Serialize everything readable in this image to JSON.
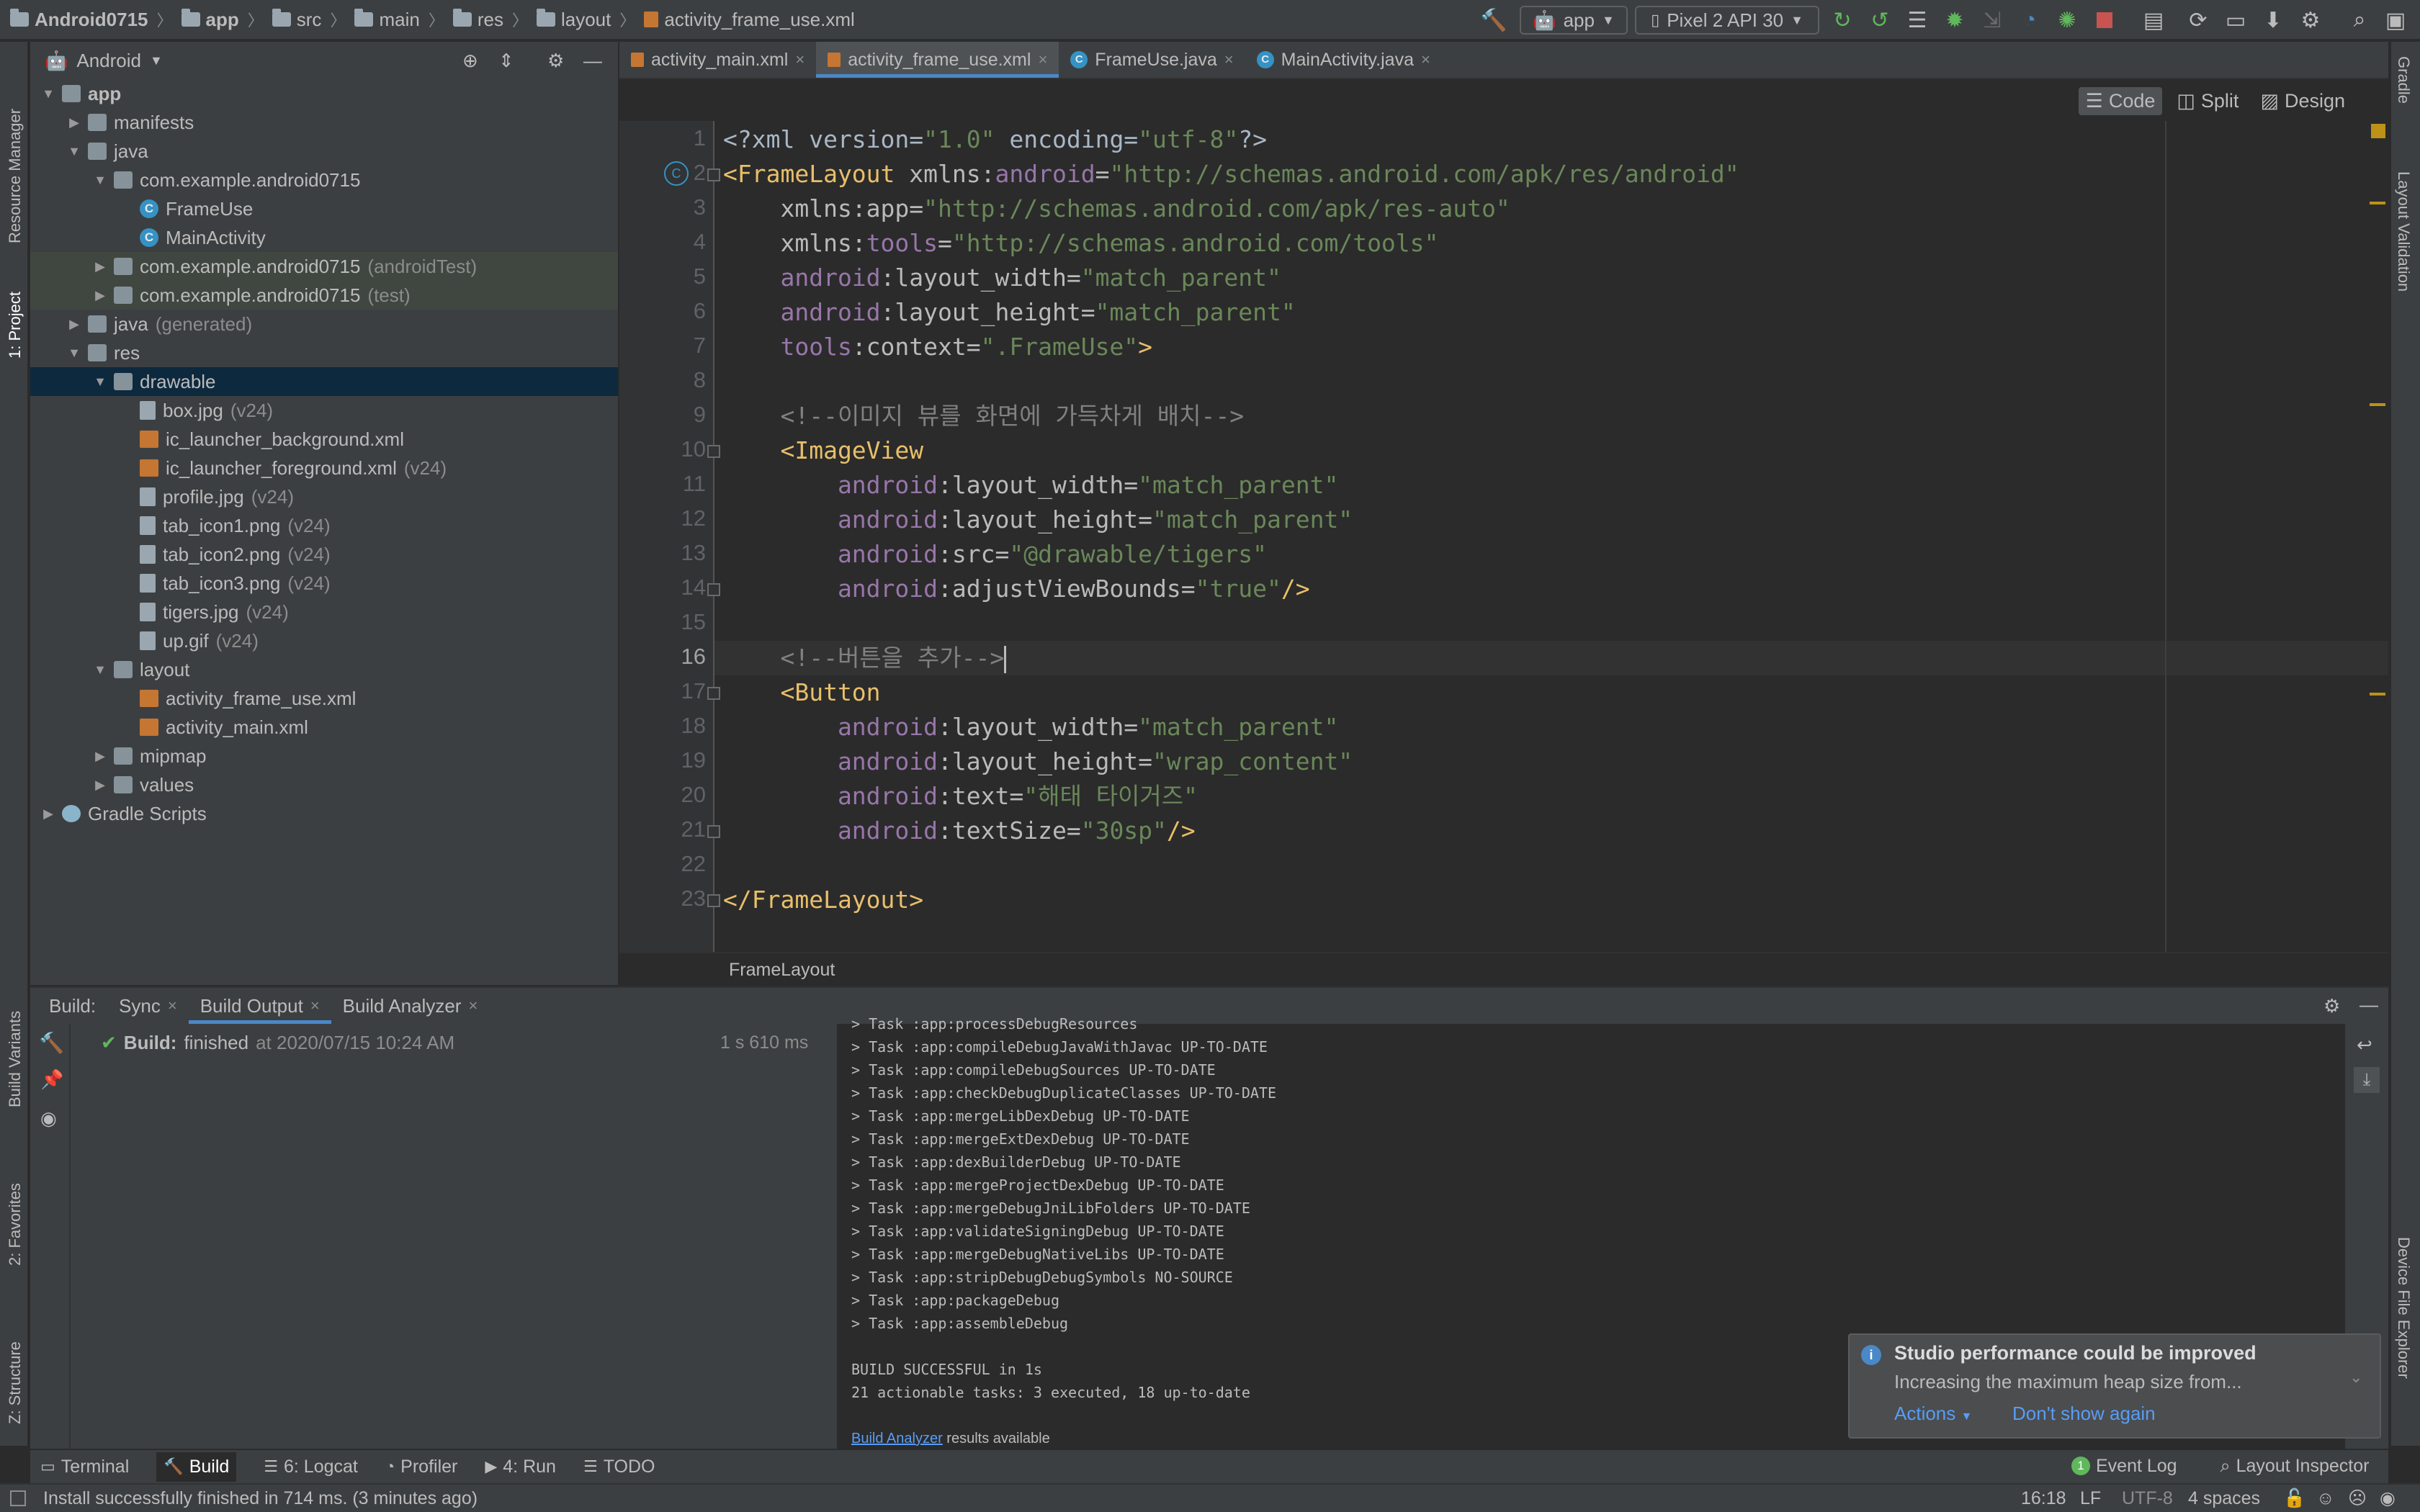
{
  "navbar": {
    "breadcrumbs": [
      "Android0715",
      "app",
      "src",
      "main",
      "res",
      "layout",
      "activity_frame_use.xml"
    ],
    "run_config": "app",
    "device": "Pixel 2 API 30"
  },
  "left_stripe": {
    "resource_manager": "Resource Manager",
    "project": "1: Project",
    "build_variants": "Build Variants",
    "favorites": "2: Favorites",
    "structure": "Z: Structure"
  },
  "right_stripe": {
    "gradle": "Gradle",
    "layout_validation": "Layout Validation",
    "device_file_explorer": "Device File Explorer"
  },
  "project_panel": {
    "view_mode": "Android",
    "tree": [
      {
        "label": "app",
        "suffix": "",
        "icon": "folder-icon",
        "level": 0,
        "arrow": "▼"
      },
      {
        "label": "manifests",
        "suffix": "",
        "icon": "folder-icon",
        "level": 1,
        "arrow": "▶"
      },
      {
        "label": "java",
        "suffix": "",
        "icon": "folder-icon",
        "level": 1,
        "arrow": "▼"
      },
      {
        "label": "com.example.android0715",
        "suffix": "",
        "icon": "package-icon",
        "level": 2,
        "arrow": "▼"
      },
      {
        "label": "FrameUse",
        "suffix": "",
        "icon": "class-icon",
        "level": 3,
        "arrow": ""
      },
      {
        "label": "MainActivity",
        "suffix": "",
        "icon": "class-icon",
        "level": 3,
        "arrow": ""
      },
      {
        "label": "com.example.android0715",
        "suffix": "(androidTest)",
        "icon": "package-icon",
        "level": 2,
        "arrow": "▶"
      },
      {
        "label": "com.example.android0715",
        "suffix": "(test)",
        "icon": "package-icon",
        "level": 2,
        "arrow": "▶"
      },
      {
        "label": "java",
        "suffix": "(generated)",
        "icon": "folder-icon",
        "level": 1,
        "arrow": "▶"
      },
      {
        "label": "res",
        "suffix": "",
        "icon": "folder-icon",
        "level": 1,
        "arrow": "▼"
      },
      {
        "label": "drawable",
        "suffix": "",
        "icon": "folder-icon",
        "level": 2,
        "arrow": "▼"
      },
      {
        "label": "box.jpg",
        "suffix": "(v24)",
        "icon": "image-file-icon",
        "level": 3,
        "arrow": ""
      },
      {
        "label": "ic_launcher_background.xml",
        "suffix": "",
        "icon": "xml-file-icon",
        "level": 3,
        "arrow": ""
      },
      {
        "label": "ic_launcher_foreground.xml",
        "suffix": "(v24)",
        "icon": "xml-file-icon",
        "level": 3,
        "arrow": ""
      },
      {
        "label": "profile.jpg",
        "suffix": "(v24)",
        "icon": "image-file-icon",
        "level": 3,
        "arrow": ""
      },
      {
        "label": "tab_icon1.png",
        "suffix": "(v24)",
        "icon": "image-file-icon",
        "level": 3,
        "arrow": ""
      },
      {
        "label": "tab_icon2.png",
        "suffix": "(v24)",
        "icon": "image-file-icon",
        "level": 3,
        "arrow": ""
      },
      {
        "label": "tab_icon3.png",
        "suffix": "(v24)",
        "icon": "image-file-icon",
        "level": 3,
        "arrow": ""
      },
      {
        "label": "tigers.jpg",
        "suffix": "(v24)",
        "icon": "image-file-icon",
        "level": 3,
        "arrow": ""
      },
      {
        "label": "up.gif",
        "suffix": "(v24)",
        "icon": "image-file-icon",
        "level": 3,
        "arrow": ""
      },
      {
        "label": "layout",
        "suffix": "",
        "icon": "folder-icon",
        "level": 2,
        "arrow": "▼"
      },
      {
        "label": "activity_frame_use.xml",
        "suffix": "",
        "icon": "xml-file-icon",
        "level": 3,
        "arrow": ""
      },
      {
        "label": "activity_main.xml",
        "suffix": "",
        "icon": "xml-file-icon",
        "level": 3,
        "arrow": ""
      },
      {
        "label": "mipmap",
        "suffix": "",
        "icon": "folder-icon",
        "level": 2,
        "arrow": "▶"
      },
      {
        "label": "values",
        "suffix": "",
        "icon": "folder-icon",
        "level": 2,
        "arrow": "▶"
      },
      {
        "label": "Gradle Scripts",
        "suffix": "",
        "icon": "gradle-icon",
        "level": 0,
        "arrow": "▶"
      }
    ]
  },
  "editor": {
    "tabs": [
      {
        "label": "activity_main.xml",
        "icon": "xml-file-icon",
        "active": false
      },
      {
        "label": "activity_frame_use.xml",
        "icon": "xml-file-icon",
        "active": true
      },
      {
        "label": "FrameUse.java",
        "icon": "class-icon",
        "active": false
      },
      {
        "label": "MainActivity.java",
        "icon": "class-icon",
        "active": false
      }
    ],
    "view_modes": {
      "code": "Code",
      "split": "Split",
      "design": "Design"
    },
    "current_line": 16,
    "lines": [
      [
        [
          "p",
          "<?xml version="
        ],
        [
          "v",
          "\"1.0\""
        ],
        [
          "p",
          " encoding="
        ],
        [
          "v",
          "\"utf-8\""
        ],
        [
          "p",
          "?>"
        ]
      ],
      [
        [
          "t",
          "<FrameLayout "
        ],
        [
          "a",
          "xmlns:"
        ],
        [
          "ns",
          "android"
        ],
        [
          "a",
          "="
        ],
        [
          "v",
          "\"http://schemas.android.com/apk/res/android\""
        ]
      ],
      [
        [
          "a",
          "    xmlns:app="
        ],
        [
          "v",
          "\"http://schemas.android.com/apk/res-auto\""
        ]
      ],
      [
        [
          "a",
          "    xmlns:"
        ],
        [
          "ns",
          "tools"
        ],
        [
          "a",
          "="
        ],
        [
          "v",
          "\"http://schemas.android.com/tools\""
        ]
      ],
      [
        [
          "ns",
          "    android"
        ],
        [
          "a",
          ":layout_width="
        ],
        [
          "v",
          "\"match_parent\""
        ]
      ],
      [
        [
          "ns",
          "    android"
        ],
        [
          "a",
          ":layout_height="
        ],
        [
          "v",
          "\"match_parent\""
        ]
      ],
      [
        [
          "ns",
          "    tools"
        ],
        [
          "a",
          ":context="
        ],
        [
          "v",
          "\".FrameUse\""
        ],
        [
          "t",
          ">"
        ]
      ],
      [],
      [
        [
          "c",
          "    <!--이미지 뷰를 화면에 가득차게 배치-->"
        ]
      ],
      [
        [
          "t",
          "    <ImageView"
        ]
      ],
      [
        [
          "ns",
          "        android"
        ],
        [
          "a",
          ":layout_width="
        ],
        [
          "v",
          "\"match_parent\""
        ]
      ],
      [
        [
          "ns",
          "        android"
        ],
        [
          "a",
          ":layout_height="
        ],
        [
          "v",
          "\"match_parent\""
        ]
      ],
      [
        [
          "ns",
          "        android"
        ],
        [
          "a",
          ":src="
        ],
        [
          "v",
          "\"@drawable/tigers\""
        ]
      ],
      [
        [
          "ns",
          "        android"
        ],
        [
          "a",
          ":adjustViewBounds="
        ],
        [
          "v",
          "\"true\""
        ],
        [
          "t",
          "/>"
        ]
      ],
      [],
      [
        [
          "c",
          "    <!--버튼을 추가-->"
        ]
      ],
      [
        [
          "t",
          "    <Button"
        ]
      ],
      [
        [
          "ns",
          "        android"
        ],
        [
          "a",
          ":layout_width="
        ],
        [
          "v",
          "\"match_parent\""
        ]
      ],
      [
        [
          "ns",
          "        android"
        ],
        [
          "a",
          ":layout_height="
        ],
        [
          "v",
          "\"wrap_content\""
        ]
      ],
      [
        [
          "ns",
          "        android"
        ],
        [
          "a",
          ":text="
        ],
        [
          "v",
          "\"해태 타이거즈\""
        ]
      ],
      [
        [
          "ns",
          "        android"
        ],
        [
          "a",
          ":textSize="
        ],
        [
          "v",
          "\"30sp\""
        ],
        [
          "t",
          "/>"
        ]
      ],
      [],
      [
        [
          "t",
          "</FrameLayout>"
        ]
      ]
    ],
    "breadcrumb": "FrameLayout"
  },
  "build": {
    "label": "Build:",
    "tabs": [
      {
        "label": "Sync",
        "active": false
      },
      {
        "label": "Build Output",
        "active": true
      },
      {
        "label": "Build Analyzer",
        "active": false
      }
    ],
    "status_bold": "Build:",
    "status": "finished",
    "status_time": "at 2020/07/15 10:24 AM",
    "duration": "1 s 610 ms",
    "output": [
      "> Task :app:processDebugResources",
      "> Task :app:compileDebugJavaWithJavac UP-TO-DATE",
      "> Task :app:compileDebugSources UP-TO-DATE",
      "> Task :app:checkDebugDuplicateClasses UP-TO-DATE",
      "> Task :app:mergeLibDexDebug UP-TO-DATE",
      "> Task :app:mergeExtDexDebug UP-TO-DATE",
      "> Task :app:dexBuilderDebug UP-TO-DATE",
      "> Task :app:mergeProjectDexDebug UP-TO-DATE",
      "> Task :app:mergeDebugJniLibFolders UP-TO-DATE",
      "> Task :app:validateSigningDebug UP-TO-DATE",
      "> Task :app:mergeDebugNativeLibs UP-TO-DATE",
      "> Task :app:stripDebugDebugSymbols NO-SOURCE",
      "> Task :app:packageDebug",
      "> Task :app:assembleDebug",
      "",
      "BUILD SUCCESSFUL in 1s",
      "21 actionable tasks: 3 executed, 18 up-to-date",
      ""
    ],
    "analyzer_link": "Build Analyzer",
    "analyzer_suffix": " results available"
  },
  "notification": {
    "title": "Studio performance could be improved",
    "body": "Increasing the maximum heap size from...",
    "actions": "Actions",
    "dismiss": "Don't show again"
  },
  "tool_windows": [
    {
      "label": "Terminal",
      "icon": "terminal-icon"
    },
    {
      "label": "Build",
      "icon": "hammer-icon"
    },
    {
      "label": "6: Logcat",
      "icon": "logcat-icon"
    },
    {
      "label": "Profiler",
      "icon": "profiler-icon"
    },
    {
      "label": "4: Run",
      "icon": "run-icon"
    },
    {
      "label": "TODO",
      "icon": "todo-icon"
    }
  ],
  "tool_windows_right": {
    "event_log": "Event Log",
    "event_count": "1",
    "layout_inspector": "Layout Inspector"
  },
  "status": {
    "message": "Install successfully finished in 714 ms. (3 minutes ago)",
    "position": "16:18",
    "line_sep": "LF",
    "encoding": "UTF-8",
    "indent": "4 spaces"
  }
}
